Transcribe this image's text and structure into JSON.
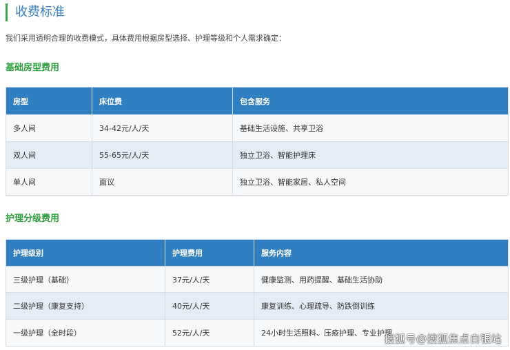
{
  "title": "收费标准",
  "intro": "我们采用透明合理的收费模式，具体费用根据房型选择、护理等级和个人需求确定：",
  "room": {
    "heading": "基础房型费用",
    "headers": [
      "房型",
      "床位费",
      "包含服务"
    ],
    "rows": [
      [
        "多人间",
        "34-42元/人/天",
        "基础生活设施、共享卫浴"
      ],
      [
        "双人间",
        "55-65元/人/天",
        "独立卫浴、智能护理床"
      ],
      [
        "单人间",
        "面议",
        "独立卫浴、智能家居、私人空间"
      ]
    ]
  },
  "care": {
    "heading": "护理分级费用",
    "headers": [
      "护理级别",
      "护理费用",
      "服务内容"
    ],
    "rows": [
      [
        "三级护理（基础）",
        "37元/人/天",
        "健康监测、用药提醒、基础生活协助"
      ],
      [
        "二级护理（康复支持）",
        "40元/人/天",
        "康复训练、心理疏导、防跌倒训练"
      ],
      [
        "一级护理（全时段）",
        "52元/人/天",
        "24小时生活照料、压疮护理、专业护理"
      ]
    ]
  },
  "watermark": "搜狐号@搜狐焦点白银站"
}
